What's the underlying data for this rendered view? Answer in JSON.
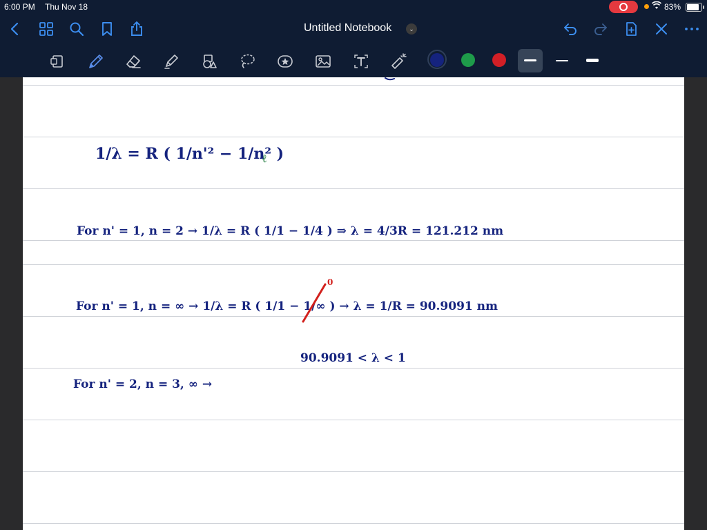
{
  "status": {
    "time": "6:00 PM",
    "date": "Thu Nov 18",
    "battery": "83%"
  },
  "document": {
    "title": "Untitled Notebook"
  },
  "colors": {
    "navy": "#15237e",
    "green": "#1e7a3c",
    "red": "#d2201c",
    "accent": "#3c8ef0"
  },
  "notes": {
    "formula": "1/λ = R ( 1/n'² − 1/n² )",
    "line1": "For n' = 1, n = 2 → 1/λ = R ( 1/1 − 1/4 ) ⇒ λ = 4/3R = 121.212 nm",
    "line2": "For n' = 1, n = ∞ → 1/λ = R ( 1/1 − 1/∞ ) → λ = 1/R = 90.9091 nm",
    "red_zero": "0",
    "range": "90.9091 < λ < 1",
    "line3": "For n' = 2, n = 3, ∞ →"
  }
}
